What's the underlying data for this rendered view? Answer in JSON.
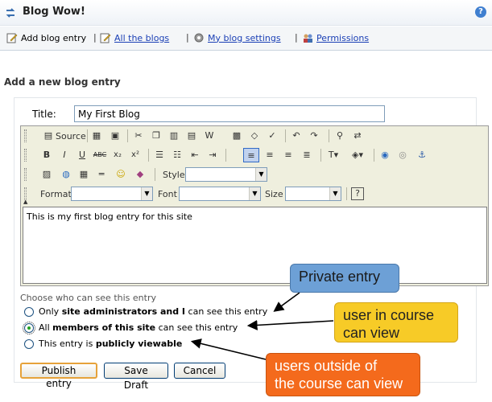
{
  "app": {
    "title": "Blog Wow!",
    "help": "?"
  },
  "nav": {
    "add": "Add blog entry",
    "all": "All the blogs",
    "settings": "My blog settings",
    "permissions": "Permissions",
    "sep": "|"
  },
  "section_heading": "Add a new blog entry",
  "form": {
    "title_label": "Title:",
    "title_value": "My First Blog",
    "body_text": "This is my first blog entry for this site"
  },
  "toolbar": {
    "source": "Source",
    "style_label": "Style",
    "format_label": "Format",
    "font_label": "Font",
    "size_label": "Size",
    "bold": "B",
    "italic": "I",
    "underline": "U",
    "strike": "ABC",
    "sub": "x₂",
    "sup": "x²",
    "help": "?"
  },
  "visibility": {
    "label": "Choose who can see this entry",
    "opt1_pre": "Only ",
    "opt1_bold": "site administrators and I",
    "opt1_post": " can see this entry",
    "opt2_pre": "All ",
    "opt2_bold": "members of this site",
    "opt2_post": " can see this entry",
    "opt3_pre": "This entry is ",
    "opt3_bold": "publicly viewable",
    "selected": 2
  },
  "buttons": {
    "publish": "Publish entry",
    "draft": "Save Draft",
    "cancel": "Cancel"
  },
  "callouts": {
    "private": "Private entry",
    "course_line1": "user in course",
    "course_line2": "can view",
    "outside_line1": "users outside of",
    "outside_line2": "the course can view"
  },
  "colors": {
    "link": "#1a3fb5",
    "callout_blue": "#6da0d6",
    "callout_yellow": "#f7cb27",
    "callout_orange": "#f46a1c"
  }
}
